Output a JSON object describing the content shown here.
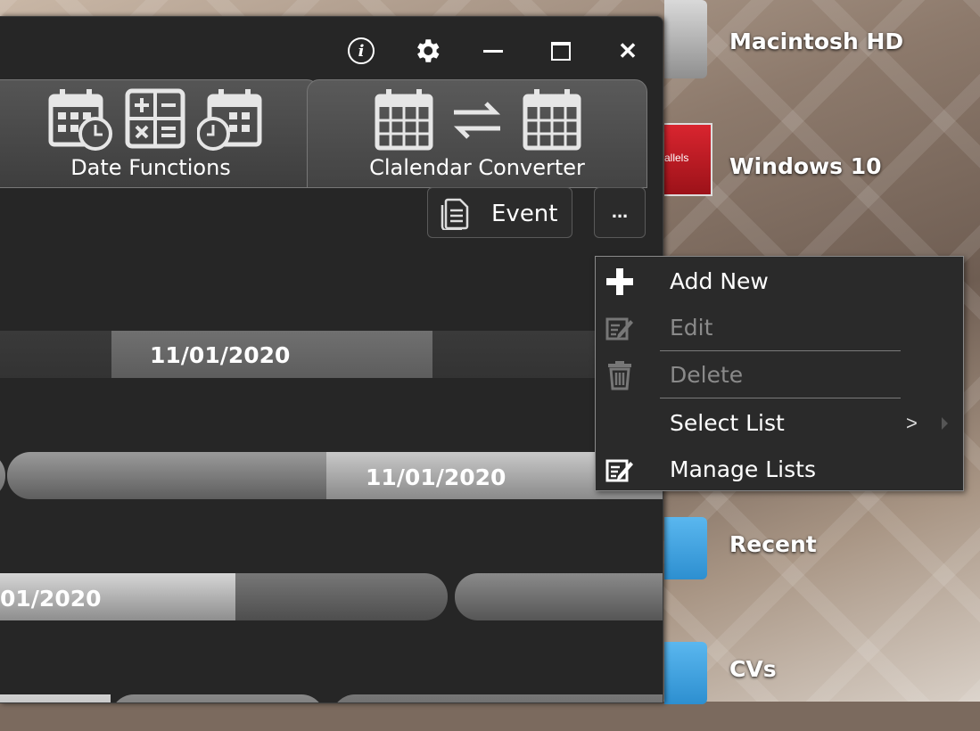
{
  "desktop": {
    "icons": [
      {
        "label": "Macintosh HD",
        "icon": "hard-drive-icon"
      },
      {
        "label": "Windows 10",
        "icon": "parallels-icon",
        "badge": "allels"
      },
      {
        "label": "Recent",
        "icon": "folder-icon"
      },
      {
        "label": "CVs",
        "icon": "folder-icon"
      }
    ]
  },
  "titlebar": {
    "info_glyph": "i",
    "close_glyph": "✕"
  },
  "tabs": [
    {
      "label": "Date Functions"
    },
    {
      "label": "Clalendar Converter"
    }
  ],
  "toolbar": {
    "event_label": "Event",
    "more_label": "..."
  },
  "timeline": {
    "row1_date": "11/01/2020",
    "row2_date": "11/01/2020",
    "row3_date": "01/2020"
  },
  "menu": {
    "items": [
      {
        "label": "Add New",
        "icon": "plus-icon",
        "enabled": true
      },
      {
        "label": "Edit",
        "icon": "edit-icon",
        "enabled": false
      },
      {
        "label": "Delete",
        "icon": "trash-icon",
        "enabled": false
      },
      {
        "label": "Select List",
        "icon": "",
        "enabled": true,
        "submenu_indicator": ">"
      },
      {
        "label": "Manage Lists",
        "icon": "edit-icon",
        "enabled": true
      }
    ]
  },
  "colors": {
    "window_bg": "#262626",
    "menu_bg": "#2a2a2a",
    "accent_text": "#ffffff",
    "disabled_text": "#8a8a8a"
  }
}
